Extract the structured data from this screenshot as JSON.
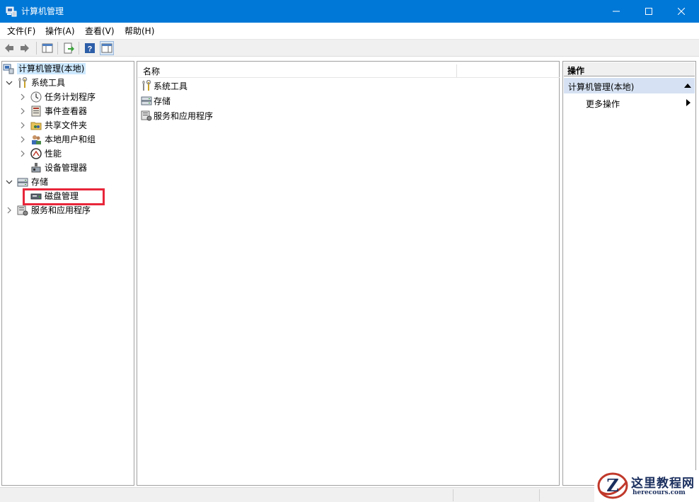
{
  "window": {
    "title": "计算机管理",
    "app_icon": "computer-management-icon",
    "accent_color": "#0078d7"
  },
  "menu": {
    "items": [
      "文件(F)",
      "操作(A)",
      "查看(V)",
      "帮助(H)"
    ]
  },
  "toolbar": {
    "buttons": [
      "back-arrow-icon",
      "forward-arrow-icon",
      "show-console-tree-icon",
      "export-list-icon",
      "help-icon",
      "action-pane-icon"
    ]
  },
  "tree": {
    "root": "计算机管理(本地)",
    "system_tools": {
      "label": "系统工具",
      "children": [
        "任务计划程序",
        "事件查看器",
        "共享文件夹",
        "本地用户和组",
        "性能",
        "设备管理器"
      ]
    },
    "storage": {
      "label": "存储",
      "children": [
        "磁盘管理"
      ]
    },
    "services": "服务和应用程序"
  },
  "content": {
    "column_name": "名称",
    "items": [
      "系统工具",
      "存储",
      "服务和应用程序"
    ]
  },
  "actions": {
    "header": "操作",
    "section": "计算机管理(本地)",
    "more": "更多操作"
  },
  "highlight": {
    "target": "磁盘管理",
    "color": "#e8263a"
  },
  "watermark": {
    "text": "这里教程网",
    "url": "herecours.com"
  }
}
